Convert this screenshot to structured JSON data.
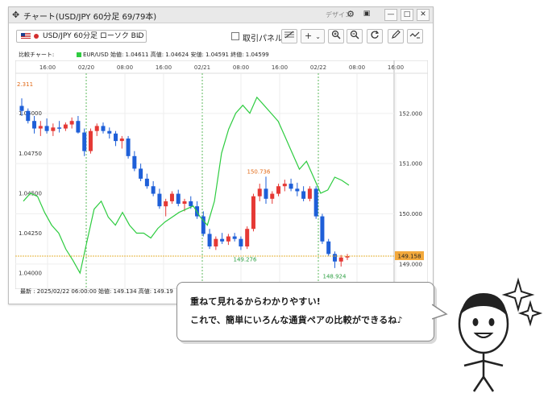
{
  "window": {
    "title": "チャート(USD/JPY 60分足 69/79本)",
    "design_label": "デザイン",
    "controls": [
      "⚙",
      "▣",
      "—",
      "□",
      "✕"
    ]
  },
  "toolbar": {
    "symbol": "USD/JPY 60分足 ローソク BID",
    "panel_label": "取引パネル",
    "panel_checked": false
  },
  "compare": {
    "label": "比較チャート:",
    "series_info": "EUR/USD 始値: 1.04611  高値: 1.04624  安値: 1.04591  終値: 1.04599",
    "series_color": "#2ecc40"
  },
  "status": {
    "text": "最新 : 2025/02/22 06:00:00  始値: 149.134  高値: 149.19"
  },
  "bubble": {
    "line1": "重ねて見れるからわかりやすい!",
    "line2": "これで、簡単にいろんな通貨ペアの比較ができるね♪"
  },
  "chart_data": {
    "type": "candlestick+line",
    "x_ticks": [
      "16:00",
      "02/20",
      "08:00",
      "16:00",
      "02/21",
      "08:00",
      "16:00",
      "02/22",
      "08:00",
      "16:00"
    ],
    "left_axis": {
      "ticks": [
        "1.05000",
        "1.04750",
        "1.04500",
        "1.04250",
        "1.04000"
      ],
      "top_label": "2.311"
    },
    "right_axis": {
      "ticks": [
        "152.000",
        "151.000",
        "150.000",
        "149.000"
      ],
      "current_price": "149.158"
    },
    "annotations": {
      "high": "150.736",
      "low1": "149.276",
      "low2": "148.924"
    },
    "candles": [
      [
        152.15,
        152.3,
        151.95,
        152.05
      ],
      [
        152.05,
        152.1,
        151.8,
        151.85
      ],
      [
        151.85,
        151.95,
        151.6,
        151.7
      ],
      [
        151.7,
        151.85,
        151.55,
        151.75
      ],
      [
        151.75,
        151.9,
        151.6,
        151.65
      ],
      [
        151.65,
        151.8,
        151.55,
        151.72
      ],
      [
        151.72,
        151.85,
        151.62,
        151.7
      ],
      [
        151.7,
        151.82,
        151.65,
        151.78
      ],
      [
        151.78,
        151.92,
        151.7,
        151.85
      ],
      [
        151.85,
        151.95,
        151.6,
        151.62
      ],
      [
        151.62,
        151.7,
        151.15,
        151.25
      ],
      [
        151.25,
        151.7,
        151.2,
        151.65
      ],
      [
        151.65,
        151.8,
        151.55,
        151.75
      ],
      [
        151.75,
        151.82,
        151.6,
        151.65
      ],
      [
        151.65,
        151.72,
        151.5,
        151.6
      ],
      [
        151.6,
        151.65,
        151.35,
        151.45
      ],
      [
        151.45,
        151.55,
        151.3,
        151.5
      ],
      [
        151.5,
        151.55,
        151.1,
        151.15
      ],
      [
        151.15,
        151.25,
        150.85,
        150.9
      ],
      [
        150.9,
        151.0,
        150.65,
        150.7
      ],
      [
        150.7,
        150.8,
        150.5,
        150.55
      ],
      [
        150.55,
        150.65,
        150.35,
        150.4
      ],
      [
        150.4,
        150.5,
        150.1,
        150.15
      ],
      [
        150.15,
        150.3,
        149.95,
        150.25
      ],
      [
        150.25,
        150.45,
        150.2,
        150.4
      ],
      [
        150.4,
        150.48,
        150.15,
        150.2
      ],
      [
        150.2,
        150.3,
        150.05,
        150.25
      ],
      [
        150.25,
        150.35,
        150.1,
        150.15
      ],
      [
        150.15,
        150.25,
        149.9,
        149.95
      ],
      [
        149.95,
        150.05,
        149.55,
        149.6
      ],
      [
        149.6,
        149.7,
        149.3,
        149.35
      ],
      [
        149.35,
        149.55,
        149.28,
        149.5
      ],
      [
        149.5,
        149.62,
        149.4,
        149.45
      ],
      [
        149.45,
        149.6,
        149.38,
        149.55
      ],
      [
        149.55,
        149.62,
        149.45,
        149.5
      ],
      [
        149.5,
        149.55,
        149.28,
        149.35
      ],
      [
        149.35,
        149.75,
        149.3,
        149.7
      ],
      [
        149.7,
        150.4,
        149.65,
        150.35
      ],
      [
        150.35,
        150.6,
        150.25,
        150.5
      ],
      [
        150.5,
        150.74,
        150.2,
        150.3
      ],
      [
        150.3,
        150.45,
        150.2,
        150.4
      ],
      [
        150.4,
        150.6,
        150.35,
        150.55
      ],
      [
        150.55,
        150.68,
        150.45,
        150.6
      ],
      [
        150.6,
        150.7,
        150.45,
        150.5
      ],
      [
        150.5,
        150.62,
        150.35,
        150.45
      ],
      [
        150.45,
        150.55,
        150.25,
        150.3
      ],
      [
        150.3,
        150.55,
        150.25,
        150.5
      ],
      [
        150.5,
        150.55,
        149.9,
        149.95
      ],
      [
        149.95,
        150.0,
        149.4,
        149.45
      ],
      [
        149.45,
        149.5,
        149.15,
        149.2
      ],
      [
        149.2,
        149.25,
        148.92,
        149.05
      ],
      [
        149.05,
        149.18,
        148.95,
        149.13
      ],
      [
        149.13,
        149.2,
        149.08,
        149.158
      ]
    ],
    "compare_line": [
      1.0445,
      1.045,
      1.0448,
      1.0438,
      1.043,
      1.0425,
      1.0415,
      1.0408,
      1.04,
      1.042,
      1.044,
      1.0445,
      1.0435,
      1.043,
      1.0438,
      1.043,
      1.0425,
      1.0425,
      1.0422,
      1.0428,
      1.0432,
      1.0435,
      1.0438,
      1.044,
      1.0442,
      1.0435,
      1.043,
      1.0445,
      1.0475,
      1.049,
      1.05,
      1.0505,
      1.05,
      1.051,
      1.0505,
      1.05,
      1.0495,
      1.0485,
      1.0475,
      1.0465,
      1.047,
      1.046,
      1.045,
      1.0452,
      1.046,
      1.0458,
      1.0455
    ],
    "grid": true,
    "candle_up_color": "#e53935",
    "candle_down_color": "#1e5fd8",
    "compare_color": "#2ecc40"
  }
}
